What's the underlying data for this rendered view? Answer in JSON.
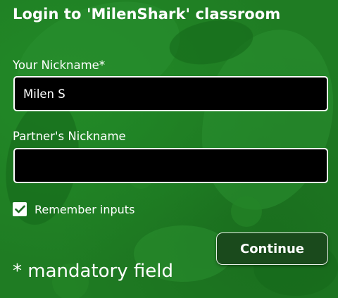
{
  "login": {
    "title": "Login to 'MilenShark' classroom",
    "nickname_label": "Your Nickname*",
    "nickname_value": "Milen S",
    "partner_label": "Partner's Nickname",
    "partner_value": "",
    "remember_label": "Remember inputs",
    "remember_checked": true,
    "continue_label": "Continue",
    "mandatory_note": "* mandatory field"
  },
  "colors": {
    "background": "#1f7c23",
    "input_background": "#000000",
    "button_background": "#1a4a1c",
    "text": "#ffffff"
  },
  "icons": {
    "checkbox": "checkmark-icon"
  }
}
